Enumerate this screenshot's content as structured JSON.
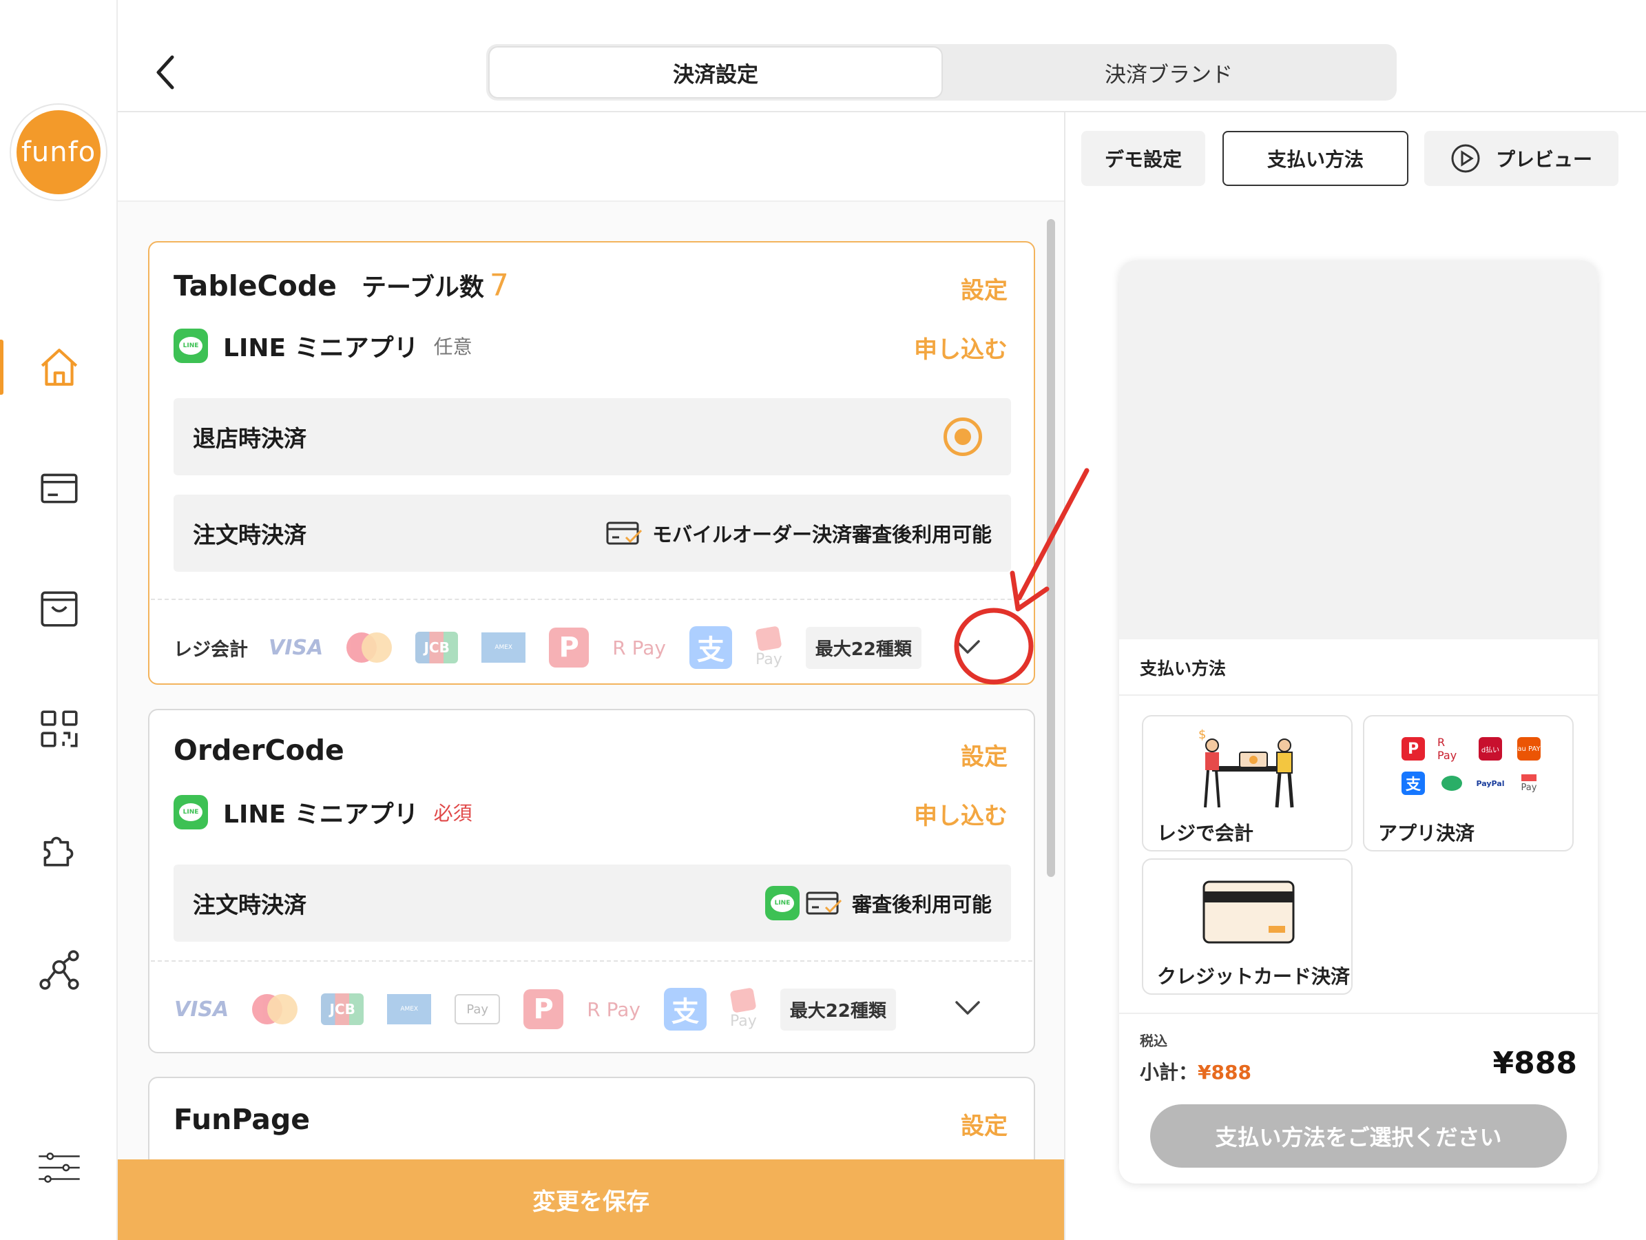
{
  "logo": {
    "text": "funfo"
  },
  "header": {
    "tabs": [
      {
        "label": "決済設定"
      },
      {
        "label": "決済ブランド"
      }
    ]
  },
  "colors": {
    "accent": "#f3a640",
    "line_green": "#3dc154",
    "required_red": "#e04848"
  },
  "cards": {
    "tablecode": {
      "title": "TableCode",
      "tables_label": "テーブル数",
      "tables_count": "7",
      "settings_link": "設定",
      "line": {
        "name": "LINE ミニアプリ",
        "tag": "任意",
        "apply": "申し込む"
      },
      "options": [
        {
          "label": "退店時決済",
          "selected": true
        },
        {
          "label": "注文時決済",
          "note": "モバイルオーダー決済審査後利用可能"
        }
      ],
      "register_label": "レジ会計",
      "brand_icons": [
        "VISA",
        "mastercard",
        "JCB",
        "AMERICAN EXPRESS",
        "PayPay",
        "R Pay",
        "Alipay",
        "merpay"
      ],
      "rpay_text": "R Pay",
      "merpay_text": "Pay",
      "max_badge": "最大22種類"
    },
    "ordercode": {
      "title": "OrderCode",
      "settings_link": "設定",
      "line": {
        "name": "LINE ミニアプリ",
        "tag": "必須",
        "apply": "申し込む"
      },
      "options": [
        {
          "label": "注文時決済",
          "note": "審査後利用可能"
        }
      ],
      "rpay_text": "R Pay",
      "merpay_text": "Pay",
      "applepay_text": "Pay",
      "max_badge": "最大22種類"
    },
    "funpage": {
      "title": "FunPage",
      "settings_link": "設定"
    }
  },
  "save_button": "変更を保存",
  "right": {
    "buttons": [
      {
        "label": "デモ設定"
      },
      {
        "label": "支払い方法"
      },
      {
        "label": "プレビュー"
      }
    ],
    "preview": {
      "section_title": "支払い方法",
      "methods": [
        {
          "label": "レジで会計"
        },
        {
          "label": "アプリ決済"
        },
        {
          "label": "クレジットカード決済"
        }
      ],
      "app_icon_texts": [
        "R Pay",
        "d払い",
        "au PAY",
        "PayPal",
        "Pay"
      ],
      "tax_label": "税込",
      "subtotal_label": "小計：",
      "subtotal_amount": "¥888",
      "total": "¥888",
      "pay_button": "支払い方法をご選択ください"
    }
  }
}
